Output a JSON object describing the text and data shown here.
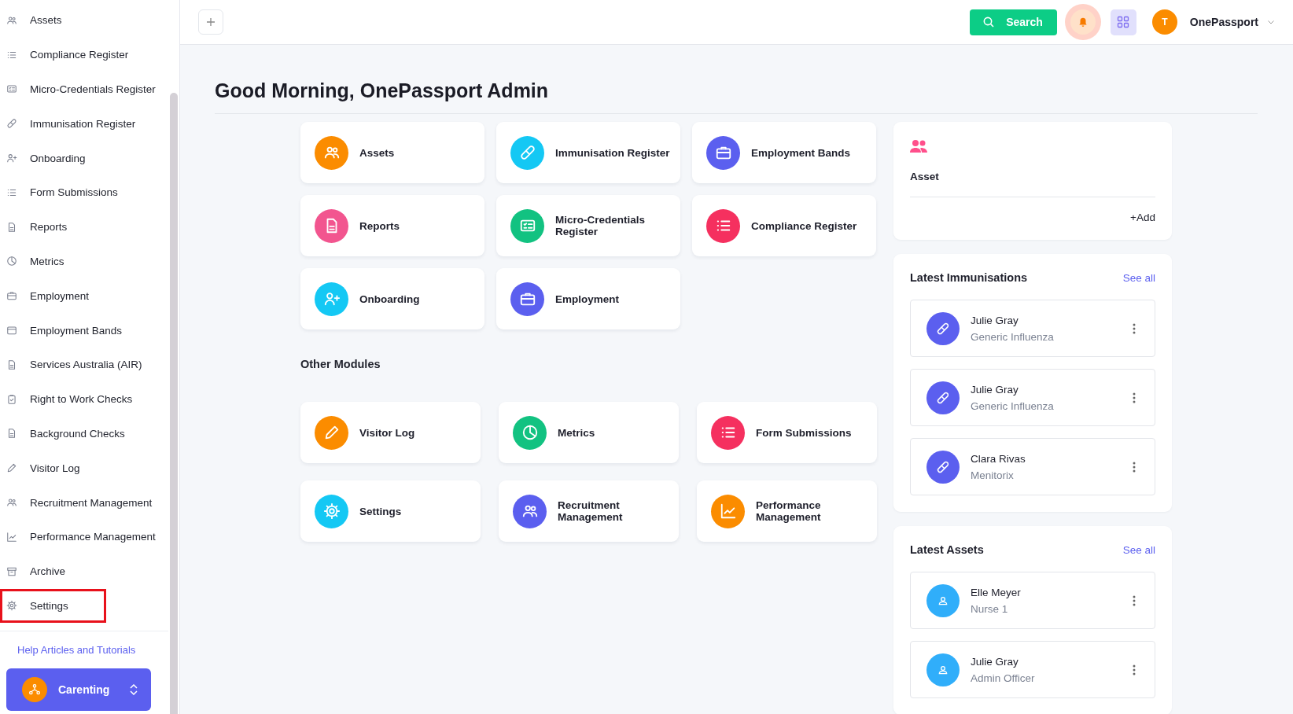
{
  "sidebar": {
    "items": [
      {
        "label": "Assets",
        "highlighted": false
      },
      {
        "label": "Compliance Register",
        "highlighted": false
      },
      {
        "label": "Micro-Credentials Register",
        "highlighted": false
      },
      {
        "label": "Immunisation Register",
        "highlighted": false
      },
      {
        "label": "Onboarding",
        "highlighted": false
      },
      {
        "label": "Form Submissions",
        "highlighted": false
      },
      {
        "label": "Reports",
        "highlighted": false
      },
      {
        "label": "Metrics",
        "highlighted": false
      },
      {
        "label": "Employment",
        "highlighted": false
      },
      {
        "label": "Employment Bands",
        "highlighted": false
      },
      {
        "label": "Services Australia (AIR)",
        "highlighted": false
      },
      {
        "label": "Right to Work Checks",
        "highlighted": false
      },
      {
        "label": "Background Checks",
        "highlighted": false
      },
      {
        "label": "Visitor Log",
        "highlighted": false
      },
      {
        "label": "Recruitment Management",
        "highlighted": false
      },
      {
        "label": "Performance Management",
        "highlighted": false
      },
      {
        "label": "Archive",
        "highlighted": false
      },
      {
        "label": "Settings",
        "highlighted": true
      }
    ],
    "help_link": "Help Articles and Tutorials",
    "org_switcher": {
      "label": "Carenting"
    }
  },
  "topbar": {
    "search_button": "Search",
    "user": {
      "initial": "T",
      "name": "OnePassport"
    }
  },
  "greeting": "Good Morning, OnePassport Admin",
  "modules": [
    {
      "label": "Assets",
      "color": "#fb8c00"
    },
    {
      "label": "Immunisation Register",
      "color": "#14c8f4"
    },
    {
      "label": "Employment Bands",
      "color": "#5b5fef"
    },
    {
      "label": "Reports",
      "color": "#f2558f"
    },
    {
      "label": "Micro-Credentials Register",
      "color": "#12c281"
    },
    {
      "label": "Compliance Register",
      "color": "#f5305f"
    },
    {
      "label": "Onboarding",
      "color": "#14c8f4"
    },
    {
      "label": "Employment",
      "color": "#5b5fef"
    }
  ],
  "other_modules": {
    "title": "Other Modules",
    "items": [
      {
        "label": "Visitor Log",
        "color": "#fb8c00"
      },
      {
        "label": "Metrics",
        "color": "#12c281"
      },
      {
        "label": "Form Submissions",
        "color": "#f5305f"
      },
      {
        "label": "Settings",
        "color": "#14c8f4"
      },
      {
        "label": "Recruitment Management",
        "color": "#5b5fef"
      },
      {
        "label": "Performance Management",
        "color": "#fb8c00"
      }
    ]
  },
  "quick_add": {
    "label": "Asset",
    "action": "+Add"
  },
  "latest_immunisations": {
    "title": "Latest Immunisations",
    "see_all": "See all",
    "items": [
      {
        "name": "Julie Gray",
        "detail": "Generic Influenza"
      },
      {
        "name": "Julie Gray",
        "detail": "Generic Influenza"
      },
      {
        "name": "Clara Rivas",
        "detail": "Menitorix"
      }
    ]
  },
  "latest_assets": {
    "title": "Latest Assets",
    "see_all": "See all",
    "items": [
      {
        "name": "Elle Meyer",
        "detail": "Nurse 1"
      },
      {
        "name": "Julie Gray",
        "detail": "Admin Officer"
      }
    ]
  }
}
